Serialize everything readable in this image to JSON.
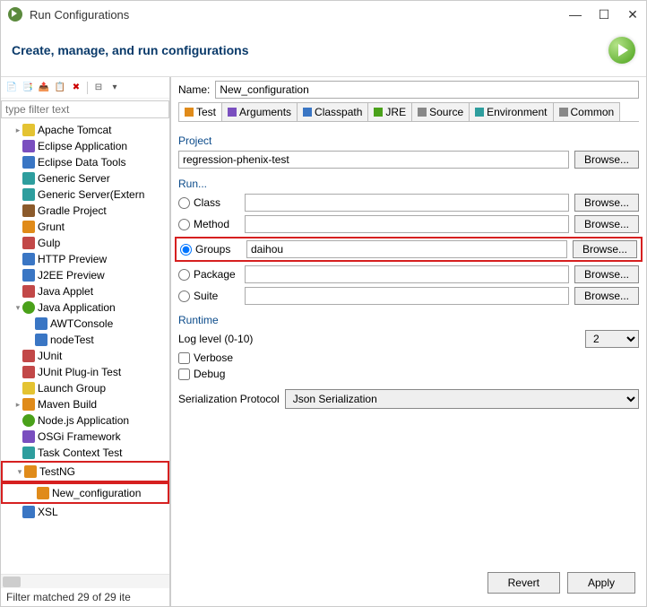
{
  "window": {
    "title": "Run Configurations"
  },
  "header": {
    "title": "Create, manage, and run configurations"
  },
  "left": {
    "filter_placeholder": "type filter text",
    "tree": [
      {
        "label": "Apache Tomcat",
        "icon": "yellow",
        "expand": ">"
      },
      {
        "label": "Eclipse Application",
        "icon": "purple"
      },
      {
        "label": "Eclipse Data Tools",
        "icon": "blue"
      },
      {
        "label": "Generic Server",
        "icon": "teal"
      },
      {
        "label": "Generic Server(Extern",
        "icon": "teal"
      },
      {
        "label": "Gradle Project",
        "icon": "brown"
      },
      {
        "label": "Grunt",
        "icon": "orange"
      },
      {
        "label": "Gulp",
        "icon": "red"
      },
      {
        "label": "HTTP Preview",
        "icon": "blue"
      },
      {
        "label": "J2EE Preview",
        "icon": "blue"
      },
      {
        "label": "Java Applet",
        "icon": "red"
      },
      {
        "label": "Java Application",
        "icon": "green",
        "expand": "v",
        "children": [
          {
            "label": "AWTConsole",
            "icon": "blue"
          },
          {
            "label": "nodeTest",
            "icon": "blue"
          }
        ]
      },
      {
        "label": "JUnit",
        "icon": "red"
      },
      {
        "label": "JUnit Plug-in Test",
        "icon": "red"
      },
      {
        "label": "Launch Group",
        "icon": "yellow"
      },
      {
        "label": "Maven Build",
        "icon": "orange",
        "expand": ">"
      },
      {
        "label": "Node.js Application",
        "icon": "green"
      },
      {
        "label": "OSGi Framework",
        "icon": "purple"
      },
      {
        "label": "Task Context Test",
        "icon": "teal"
      },
      {
        "label": "TestNG",
        "icon": "orange",
        "expand": "v",
        "highlight": true,
        "children": [
          {
            "label": "New_configuration",
            "icon": "orange",
            "highlight": true
          }
        ]
      },
      {
        "label": "XSL",
        "icon": "blue"
      }
    ],
    "status": "Filter matched 29 of 29 ite"
  },
  "right": {
    "name_label": "Name:",
    "name_value": "New_configuration",
    "tabs": [
      "Test",
      "Arguments",
      "Classpath",
      "JRE",
      "Source",
      "Environment",
      "Common"
    ],
    "project_label": "Project",
    "project_value": "regression-phenix-test",
    "browse_label": "Browse...",
    "run_label": "Run...",
    "radios": {
      "class": "Class",
      "method": "Method",
      "groups": "Groups",
      "package": "Package",
      "suite": "Suite"
    },
    "groups_value": "daihou",
    "runtime_label": "Runtime",
    "log_label": "Log level (0-10)",
    "log_value": "2",
    "verbose_label": "Verbose",
    "debug_label": "Debug",
    "ser_label": "Serialization Protocol",
    "ser_value": "Json Serialization",
    "revert": "Revert",
    "apply": "Apply"
  }
}
